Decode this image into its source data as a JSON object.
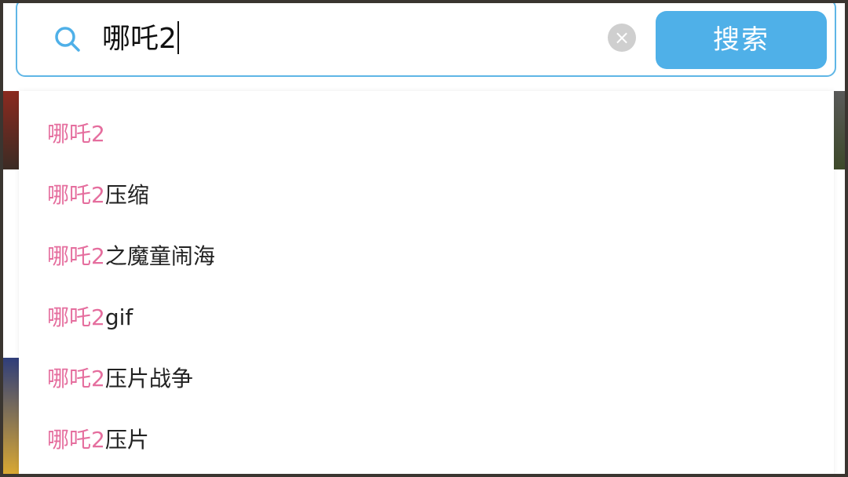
{
  "search": {
    "query": "哪吒2",
    "clear_glyph": "×",
    "button_label": "搜索"
  },
  "suggestions": [
    {
      "highlight": "哪吒2",
      "rest": ""
    },
    {
      "highlight": "哪吒2",
      "rest": "压缩"
    },
    {
      "highlight": "哪吒2",
      "rest": "之魔童闹海"
    },
    {
      "highlight": "哪吒2",
      "rest": "gif"
    },
    {
      "highlight": "哪吒2",
      "rest": "压片战争"
    },
    {
      "highlight": "哪吒2",
      "rest": "压片"
    }
  ],
  "colors": {
    "accent": "#4fb0e8",
    "highlight": "#e56e9e",
    "border": "#5fb6e6"
  },
  "icons": {
    "search": "search-icon",
    "clear": "close-icon"
  }
}
